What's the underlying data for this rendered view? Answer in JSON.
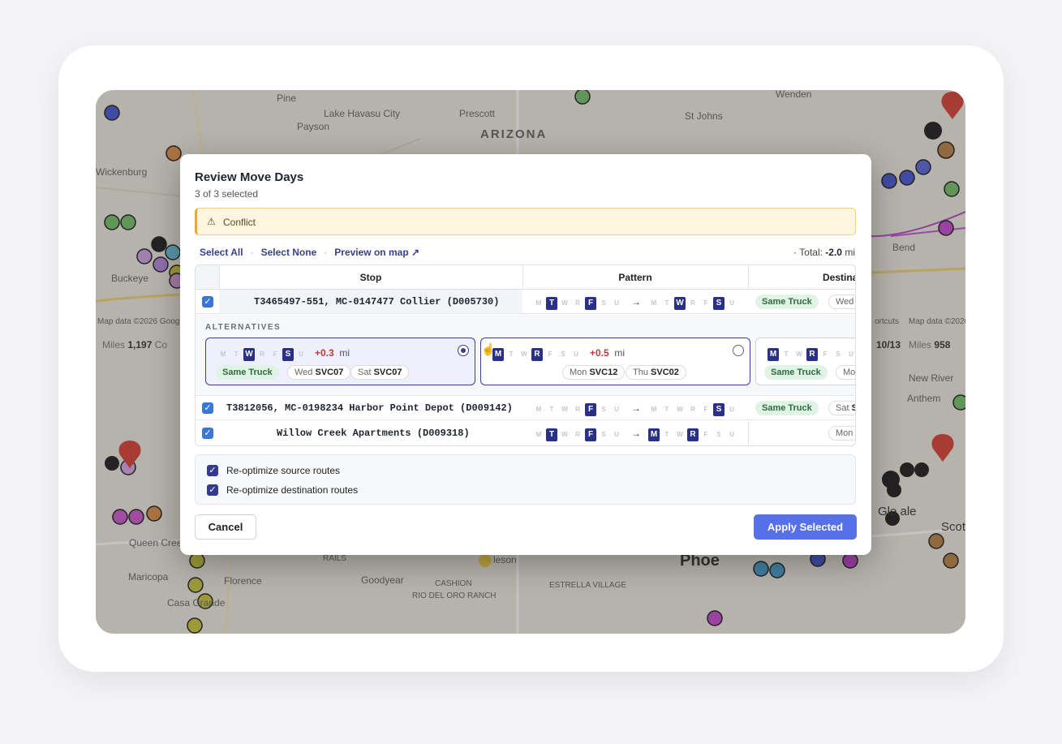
{
  "map": {
    "labels": [
      "Pine",
      "Payson",
      "Lake Havasu City",
      "Prescott",
      "ARIZONA",
      "St Johns",
      "Wenden",
      "Wickenburg",
      "Buckeye",
      "New River",
      "Anthem",
      "Bend",
      "Phoe",
      "Goodyear",
      "CASHION",
      "ESTRELLA VILLAGE",
      "RIO DEL ORO RANCH",
      "Maricopa",
      "Casa Grande",
      "Florence",
      "Queen Creek",
      "Gle ale",
      "Scot",
      "RAILS",
      "leson"
    ],
    "attribution_left": "Map data ©2026 Googl",
    "attribution_right": "Map data ©2026",
    "shortcuts": "ortcuts",
    "stats_left": {
      "label": "Miles",
      "value": "1,197",
      "extra": "Co"
    },
    "stats_right": {
      "date": "10/13",
      "label": "Miles",
      "value": "958"
    }
  },
  "modal": {
    "title": "Review Move Days",
    "subtitle": "3 of 3 selected",
    "conflict": "Conflict",
    "links": {
      "select_all": "Select All",
      "select_none": "Select None",
      "preview": "Preview on map ↗"
    },
    "total_label": "Total:",
    "total_value": "-2.0",
    "total_unit": "mi",
    "columns": {
      "stop": "Stop",
      "pattern": "Pattern",
      "destination": "Destina"
    },
    "alternatives_label": "ALTERNATIVES",
    "rows": [
      {
        "stop": "T3465497-551, MC-0147477 Collier (D005730)",
        "from_on": [
          "T",
          "F"
        ],
        "to_on": [
          "W",
          "S"
        ],
        "truck": "Same Truck",
        "dest_day": "Wed",
        "dest_svc": ""
      },
      {
        "stop": "T3812056, MC-0198234 Harbor Point Depot (D009142)",
        "from_on": [
          "F"
        ],
        "to_on": [
          "S"
        ],
        "truck": "Same Truck",
        "dest_day": "Sat",
        "dest_svc": "S"
      },
      {
        "stop": "Willow Creek Apartments (D009318)",
        "from_on": [
          "T",
          "F"
        ],
        "to_on": [
          "M",
          "R"
        ],
        "truck": "",
        "dest_day": "Mon",
        "dest_svc": ""
      }
    ],
    "alternatives": [
      {
        "on": [
          "W",
          "S"
        ],
        "delta": "+0.3",
        "unit": "mi",
        "truck": "Same Truck",
        "a_day": "Wed",
        "a_svc": "SVC07",
        "b_day": "Sat",
        "b_svc": "SVC07",
        "selected": true
      },
      {
        "on": [
          "M",
          "R"
        ],
        "delta": "+0.5",
        "unit": "mi",
        "truck": "",
        "a_day": "Mon",
        "a_svc": "SVC12",
        "b_day": "Thu",
        "b_svc": "SVC02",
        "selected": false
      },
      {
        "on": [
          "M",
          "R"
        ],
        "delta": "",
        "unit": "",
        "truck": "Same Truck",
        "a_day": "Mo",
        "a_svc": "",
        "b_day": "",
        "b_svc": "",
        "selected": false
      }
    ],
    "options": {
      "source": "Re-optimize source routes",
      "destination": "Re-optimize destination routes"
    },
    "cancel": "Cancel",
    "apply": "Apply Selected"
  },
  "colors": {
    "accent": "#5570e8",
    "day_on": "#2a2f87",
    "delta": "#c23838",
    "conflict_bg": "#fff6e0"
  },
  "icons": [
    "warning-icon",
    "checkbox-icon",
    "radio-icon",
    "arrow-right-icon",
    "cursor-hand-icon"
  ]
}
